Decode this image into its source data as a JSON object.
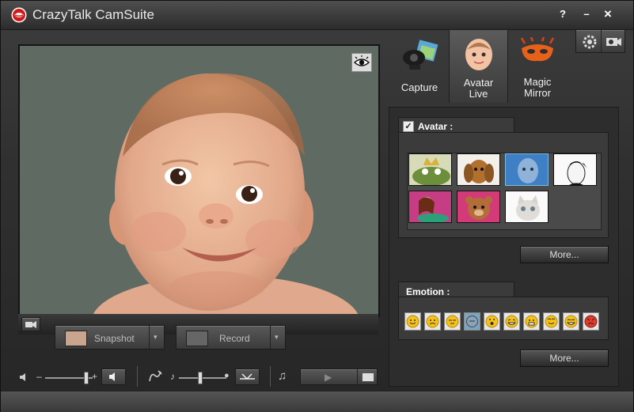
{
  "window": {
    "title": "CrazyTalk CamSuite",
    "help_label": "?",
    "minimize_label": "–",
    "close_label": "×"
  },
  "tabs": [
    {
      "label": "Capture",
      "active": false
    },
    {
      "label": "Avatar\nLive",
      "active": true
    },
    {
      "label": "Magic\nMirror",
      "active": false
    }
  ],
  "avatar_section": {
    "title": "Avatar :",
    "checked": true,
    "more_label": "More...",
    "thumbnails": [
      "frog-prince",
      "puppy",
      "baby-photo",
      "man-portrait",
      "mermaid",
      "teddy-bear",
      "kitten"
    ]
  },
  "emotion_section": {
    "title": "Emotion :",
    "more_label": "More...",
    "emotions": [
      "happy",
      "sad",
      "sleepy",
      "neutral",
      "surprised",
      "laughing",
      "worried",
      "grin",
      "big-smile",
      "angry"
    ]
  },
  "controls": {
    "snapshot_label": "Snapshot",
    "record_label": "Record",
    "volume_minus": "–",
    "volume_plus": "+"
  },
  "colors": {
    "bg": "#303030",
    "panel": "#2d2d2d",
    "accent": "#d6d6d6"
  }
}
